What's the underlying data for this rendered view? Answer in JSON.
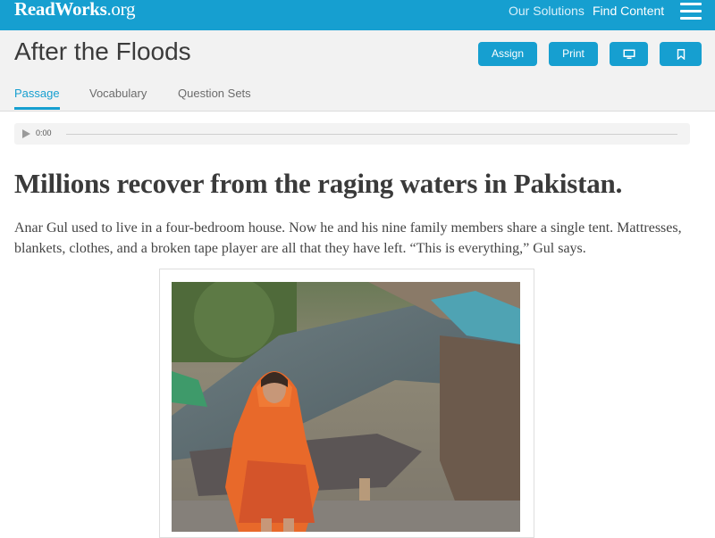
{
  "topbar": {
    "logo_main": "ReadWorks",
    "logo_suffix": ".org",
    "nav": {
      "our_solutions": "Our Solutions",
      "find_content": "Find Content"
    },
    "menu_icon": "hamburger-icon"
  },
  "header": {
    "title": "After the Floods",
    "buttons": {
      "assign": "Assign",
      "print": "Print",
      "present_icon": "monitor-icon",
      "bookmark_icon": "bookmark-icon"
    },
    "tabs": [
      {
        "label": "Passage",
        "active": true
      },
      {
        "label": "Vocabulary",
        "active": false
      },
      {
        "label": "Question Sets",
        "active": false
      }
    ]
  },
  "audio": {
    "time": "0:00",
    "progress": 0
  },
  "article": {
    "headline": "Millions recover from the raging waters in Pakistan.",
    "paragraph": "Anar Gul used to live in a four-bedroom house. Now he and his nine family members share a single tent. Mattresses, blankets, clothes, and a broken tape player are all that they have left. “This is everything,” Gul says."
  },
  "colors": {
    "brand": "#169fd0",
    "header_bg": "#f2f2f2",
    "text": "#3b3b3b"
  }
}
